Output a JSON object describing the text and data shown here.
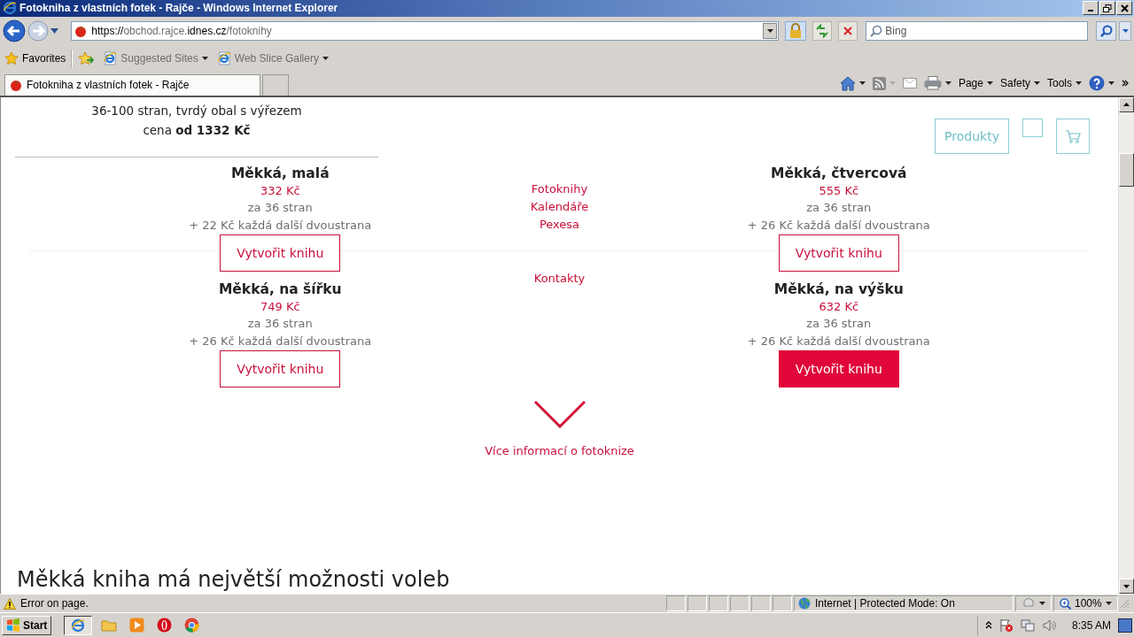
{
  "window": {
    "title": "Fotokniha z vlastních fotek - Rajče - Windows Internet Explorer"
  },
  "address_bar": {
    "url_parts": [
      {
        "text": "https://",
        "emphasis": true
      },
      {
        "text": "obchod.rajce.",
        "emphasis": false
      },
      {
        "text": "idnes.cz",
        "emphasis": true
      },
      {
        "text": "/fotoknihy",
        "emphasis": false
      }
    ]
  },
  "search": {
    "placeholder": "Bing"
  },
  "favorites_bar": {
    "favorites": "Favorites",
    "links": [
      "Suggested Sites",
      "Web Slice Gallery"
    ]
  },
  "tabs": [
    {
      "label": "Fotokniha z vlastních fotek - Rajče",
      "selected": true
    }
  ],
  "command_bar": [
    "Page",
    "Safety",
    "Tools"
  ],
  "page": {
    "intro": {
      "line": "36-100 stran, tvrdý obal s výřezem",
      "price": "cena **od 1332 Kč**"
    },
    "header_buttons": {
      "products": "Produkty"
    },
    "nav_groups": [
      [
        "Fotoknihy",
        "Kalendáře",
        "Pexesa"
      ],
      [
        "Kontakty"
      ]
    ],
    "products": [
      {
        "name": "Měkká, malá",
        "price": "332 Kč",
        "pages": "za 36 stran",
        "extra": "+ 22 Kč každá další dvoustrana",
        "button": {
          "label": "Vytvořit knihu",
          "highlighted": false
        }
      },
      {
        "name": "Měkká, čtvercová",
        "price": "555 Kč",
        "pages": "za 36 stran",
        "extra": "+ 26 Kč každá další dvoustrana",
        "button": {
          "label": "Vytvořit knihu",
          "highlighted": false
        }
      },
      {
        "name": "Měkká, na šířku",
        "price": "749 Kč",
        "pages": "za 36 stran",
        "extra": "+ 26 Kč každá další dvoustrana",
        "button": {
          "label": "Vytvořit knihu",
          "highlighted": false
        }
      },
      {
        "name": "Měkká, na výšku",
        "price": "632 Kč",
        "pages": "za 36 stran",
        "extra": "+ 26 Kč každá další dvoustrana",
        "button": {
          "label": "Vytvořit knihu",
          "highlighted": true
        }
      }
    ],
    "more_link": "Více informací o fotoknize",
    "section_heading": "Měkká kniha má největší možnosti voleb"
  },
  "status_bar": {
    "message": "Error on page.",
    "zone": "Internet | Protected Mode: On",
    "zoom": "100%"
  },
  "taskbar": {
    "start": "Start",
    "clock": "8:35 AM"
  }
}
